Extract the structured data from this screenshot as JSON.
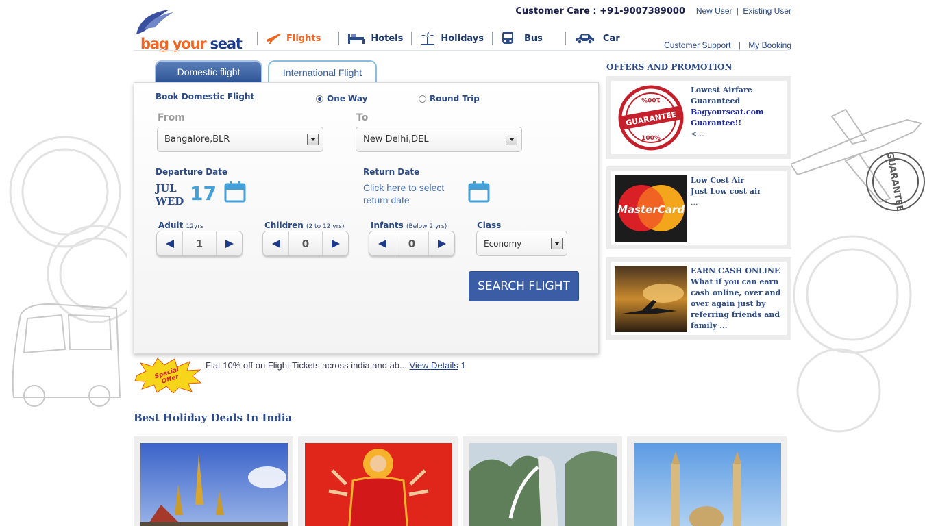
{
  "header": {
    "logo": {
      "part1": "bag your",
      "part2": "seat"
    },
    "customer_care": "Customer Care : +91-9007389000",
    "new_user": "New User",
    "existing_user": "Existing User",
    "separator": "|",
    "customer_support": "Customer Support",
    "my_booking": "My Booking",
    "nav": [
      {
        "label": "Flights",
        "icon": "plane-icon",
        "active": true
      },
      {
        "label": "Hotels",
        "icon": "bed-icon",
        "active": false
      },
      {
        "label": "Holidays",
        "icon": "palm-tree-icon",
        "active": false
      },
      {
        "label": "Bus",
        "icon": "bus-icon",
        "active": false
      },
      {
        "label": "Car",
        "icon": "car-icon",
        "active": false
      }
    ]
  },
  "tabs": {
    "domestic": "Domestic flight",
    "international": "International Flight"
  },
  "booking": {
    "heading": "Book Domestic Flight",
    "trip_one_way": "One Way",
    "trip_round": "Round Trip",
    "selected_trip": "one_way",
    "from_label": "From",
    "from_value": "Bangalore,BLR",
    "to_label": "To",
    "to_value": "New Delhi,DEL",
    "departure_label": "Departure Date",
    "dep_month": "JUL",
    "dep_weekday": "WED",
    "dep_day": "17",
    "return_label": "Return Date",
    "return_line1": "Click here to select",
    "return_line2": "return date",
    "adult_label": "Adult",
    "adult_sub": "12yrs",
    "adult_value": "1",
    "children_label": "Children",
    "children_sub": "(2 to 12 yrs)",
    "children_value": "0",
    "infants_label": "Infants",
    "infants_sub": "(Below 2 yrs)",
    "infants_value": "0",
    "class_label": "Class",
    "class_value": "Economy",
    "search_label": "SEARCH FLIGHT"
  },
  "special_offer": {
    "badge_line1": "Special",
    "badge_line2": "Offer",
    "text": "Flat 10% off on Flight Tickets across india and ab...",
    "link": "View Details",
    "count": "1"
  },
  "holiday": {
    "title": "Best Holiday Deals In India"
  },
  "promotions": {
    "title": "OFFERS AND PROMOTION",
    "items": [
      {
        "line1": "Lowest Airfare",
        "line2": "Guaranteed",
        "line3": "Bagyourseat.com",
        "line4": "Guarantee!!",
        "line5": "<...",
        "img": "guarantee-seal",
        "seal_top": "100%",
        "seal_mid": "GUARANTEE",
        "seal_bottom": "100%"
      },
      {
        "line1": "Low Cost Air",
        "line2": "Just Low cost air",
        "line3": "...",
        "img": "mastercard-logo",
        "brand": "MasterCard"
      },
      {
        "line1": "EARN CASH ONLINE",
        "line2": "What if you can earn cash online, over and over again just by referring friends and family ...",
        "img": "airplane-sunset"
      }
    ]
  },
  "colors": {
    "brand_orange": "#f26522",
    "brand_blue": "#1e3a8a",
    "panel_blue": "#3b5da6"
  }
}
